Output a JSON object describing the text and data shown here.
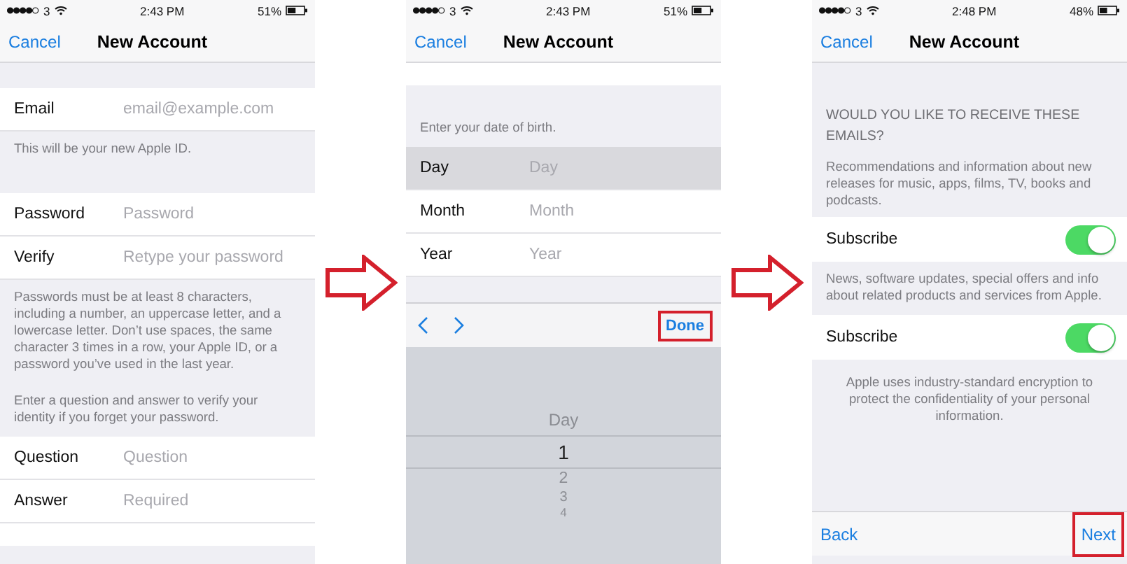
{
  "panels": [
    {
      "status": {
        "carrier": "3",
        "time": "2:43 PM",
        "battery": "51%"
      },
      "nav": {
        "cancel": "Cancel",
        "title": "New Account"
      },
      "items": [
        {
          "kind": "gap"
        },
        {
          "kind": "field",
          "label": "Email",
          "placeholder": "email@example.com",
          "selected": false
        },
        {
          "kind": "note",
          "text": "This will be your new Apple ID."
        },
        {
          "kind": "gap"
        },
        {
          "kind": "field",
          "label": "Password",
          "placeholder": "Password",
          "selected": false
        },
        {
          "kind": "field",
          "label": "Verify",
          "placeholder": "Retype your password",
          "selected": false
        },
        {
          "kind": "note",
          "text": "Passwords must be at least 8 characters, including a number, an uppercase letter, and a lowercase letter. Don’t use spaces, the same character 3 times in a row, your Apple ID, or a password you’ve used in the last year."
        },
        {
          "kind": "note",
          "text": "Enter a question and answer to verify your identity if you forget your password."
        },
        {
          "kind": "field",
          "label": "Question",
          "placeholder": "Question",
          "selected": false
        },
        {
          "kind": "field",
          "label": "Answer",
          "placeholder": "Required",
          "selected": false
        },
        {
          "kind": "blank"
        }
      ]
    },
    {
      "status": {
        "carrier": "3",
        "time": "2:43 PM",
        "battery": "51%"
      },
      "nav": {
        "cancel": "Cancel",
        "title": "New Account"
      },
      "items": [
        {
          "kind": "blank"
        },
        {
          "kind": "gap"
        },
        {
          "kind": "note",
          "text": "Enter your date of birth."
        },
        {
          "kind": "field",
          "label": "Day",
          "placeholder": "Day",
          "selected": true
        },
        {
          "kind": "field",
          "label": "Month",
          "placeholder": "Month",
          "selected": false
        },
        {
          "kind": "field",
          "label": "Year",
          "placeholder": "Year",
          "selected": false
        },
        {
          "kind": "gap"
        },
        {
          "kind": "accessory",
          "done": "Done",
          "highlighted": true
        },
        {
          "kind": "picker",
          "label": "Day",
          "values": [
            {
              "text": "1",
              "selected": true
            },
            {
              "text": "2",
              "selected": false
            },
            {
              "text": "3",
              "selected": false
            },
            {
              "text": "4",
              "selected": false
            }
          ]
        }
      ]
    },
    {
      "status": {
        "carrier": "3",
        "time": "2:48 PM",
        "battery": "48%"
      },
      "nav": {
        "cancel": "Cancel",
        "title": "New Account"
      },
      "items": [
        {
          "kind": "header",
          "title": "WOULD YOU LIKE TO RECEIVE THESE EMAILS?",
          "text": "Recommendations and information about new releases for music, apps, films, TV, books and podcasts."
        },
        {
          "kind": "toggle",
          "label": "Subscribe",
          "on": true
        },
        {
          "kind": "note",
          "text": "News, software updates, special offers and info about related products and services from Apple."
        },
        {
          "kind": "toggle",
          "label": "Subscribe",
          "on": true
        },
        {
          "kind": "footer",
          "text": "Apple uses industry-standard encryption to protect the confidentiality of your personal information."
        },
        {
          "kind": "bottombar",
          "back": "Back",
          "next": "Next",
          "highlighted": true
        }
      ]
    }
  ]
}
